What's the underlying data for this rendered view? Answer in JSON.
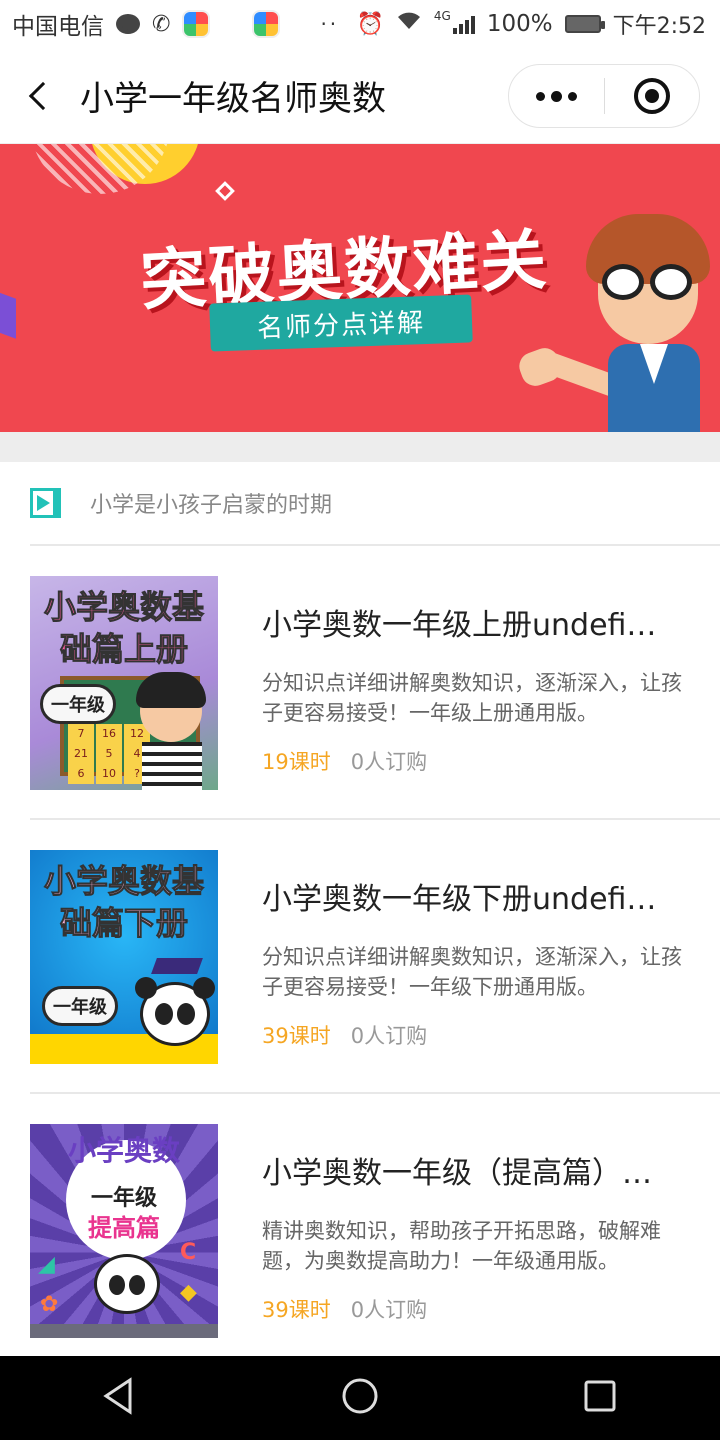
{
  "status_bar": {
    "carrier": "中国电信",
    "signal_label": "4G",
    "battery": "100%",
    "time": "下午2:52",
    "icons": [
      "message-icon",
      "missed-call-icon",
      "app-icon",
      "app-icon",
      "more-icon",
      "alarm-icon",
      "wifi-icon",
      "signal-icon",
      "battery-icon"
    ]
  },
  "header": {
    "title": "小学一年级名师奥数"
  },
  "banner": {
    "title": "突破奥数难关",
    "subtitle": "名师分点详解"
  },
  "section": {
    "heading": "小学是小孩子启蒙的时期"
  },
  "thumbnails": {
    "course1": {
      "title": "小学奥数基础篇上册",
      "grade": "一年级",
      "tiles": [
        "7",
        "16",
        "12",
        "21",
        "5",
        "4",
        "6",
        "10",
        "?"
      ]
    },
    "course2": {
      "title": "小学奥数基础篇下册",
      "grade": "一年级"
    },
    "course3": {
      "title": "小学奥数",
      "grade": "一年级",
      "level": "提高篇"
    }
  },
  "courses": [
    {
      "title": "小学奥数一年级上册undefi…",
      "description": "分知识点详细讲解奥数知识，逐渐深入，让孩子更容易接受！一年级上册通用版。",
      "lessons": "19课时",
      "subscribers": "0人订购"
    },
    {
      "title": "小学奥数一年级下册undefi…",
      "description": "分知识点详细讲解奥数知识，逐渐深入，让孩子更容易接受！一年级下册通用版。",
      "lessons": "39课时",
      "subscribers": "0人订购"
    },
    {
      "title": "小学奥数一年级（提高篇）…",
      "description": "精讲奥数知识，帮助孩子开拓思路，破解难题，为奥数提高助力！一年级通用版。",
      "lessons": "39课时",
      "subscribers": "0人订购"
    }
  ],
  "colors": {
    "banner_bg": "#f0474f",
    "accent_teal": "#22c2b8",
    "lessons_orange": "#f5a623"
  }
}
